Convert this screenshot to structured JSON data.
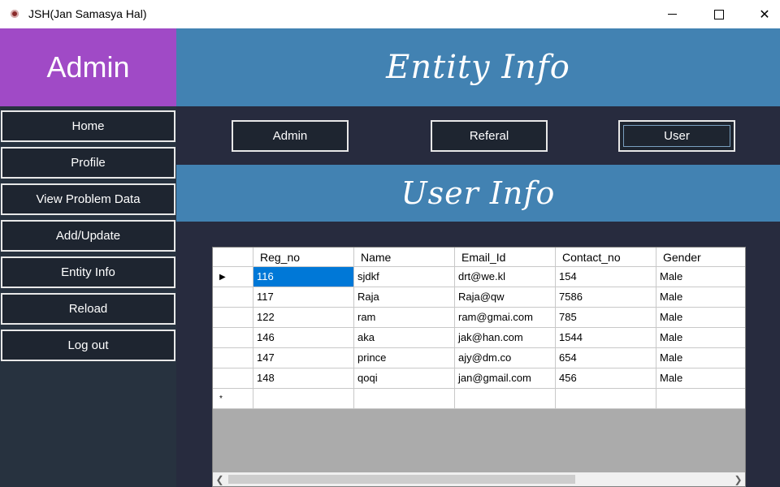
{
  "window": {
    "title": "JSH(Jan Samasya Hal)"
  },
  "sidebar": {
    "header": "Admin",
    "items": [
      {
        "label": "Home"
      },
      {
        "label": "Profile"
      },
      {
        "label": "View Problem Data"
      },
      {
        "label": "Add/Update"
      },
      {
        "label": "Entity Info"
      },
      {
        "label": "Reload"
      },
      {
        "label": "Log out"
      }
    ]
  },
  "main": {
    "title": "Entity Info",
    "tabs": [
      {
        "label": "Admin"
      },
      {
        "label": "Referal"
      },
      {
        "label": "User",
        "active": true
      }
    ],
    "section_title": "User Info"
  },
  "grid": {
    "columns": [
      "Reg_no",
      "Name",
      "Email_Id",
      "Contact_no",
      "Gender"
    ],
    "rows": [
      [
        "116",
        "sjdkf",
        "drt@we.kl",
        "154",
        "Male"
      ],
      [
        "117",
        "Raja",
        "Raja@qw",
        "7586",
        "Male"
      ],
      [
        "122",
        "ram",
        "ram@gmai.com",
        "785",
        "Male"
      ],
      [
        "146",
        "aka",
        "jak@han.com",
        "1544",
        "Male"
      ],
      [
        "147",
        "prince",
        "ajy@dm.co",
        "654",
        "Male"
      ],
      [
        "148",
        "qoqi",
        "jan@gmail.com",
        "456",
        "Male"
      ]
    ],
    "current_row_marker": "▶",
    "new_row_marker": "*"
  },
  "colors": {
    "sidebar_header": "#a04ac6",
    "banner": "#4282b2",
    "background": "#272b3e",
    "selection": "#0078d7"
  }
}
